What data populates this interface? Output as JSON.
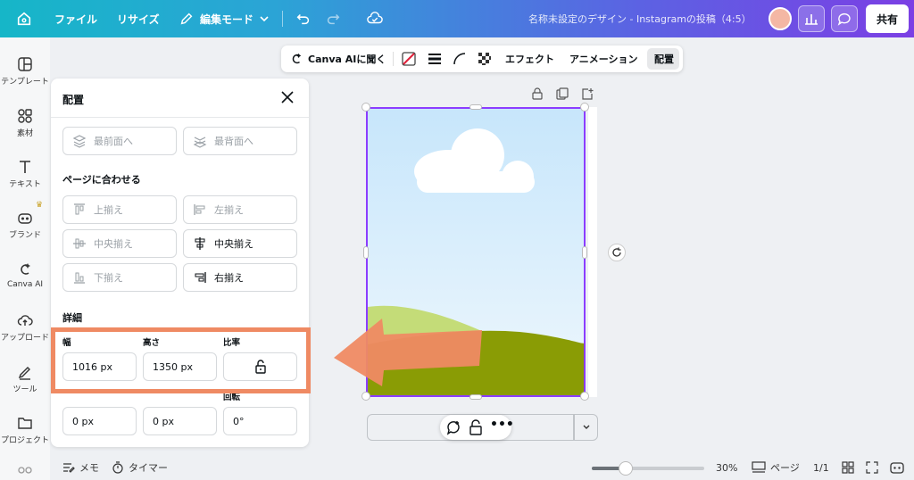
{
  "topbar": {
    "file": "ファイル",
    "resize": "リサイズ",
    "edit_mode": "編集モード",
    "doc_title": "名称未設定のデザイン - Instagramの投稿（4:5）",
    "share": "共有"
  },
  "rail": {
    "templates": "テンプレート",
    "elements": "素材",
    "text": "テキスト",
    "brand": "ブランド",
    "canva_ai": "Canva AI",
    "uploads": "アップロード",
    "tools": "ツール",
    "projects": "プロジェクト"
  },
  "context_toolbar": {
    "ask_ai": "Canva AIに聞く",
    "effects": "エフェクト",
    "animation": "アニメーション",
    "position": "配置"
  },
  "panel": {
    "title": "配置",
    "bring_front": "最前面へ",
    "send_back": "最背面へ",
    "fit_page_heading": "ページに合わせる",
    "align_top": "上揃え",
    "align_left": "左揃え",
    "align_middle": "中央揃え",
    "align_center": "中央揃え",
    "align_bottom": "下揃え",
    "align_right": "右揃え",
    "details_heading": "詳細",
    "width_label": "幅",
    "height_label": "高さ",
    "ratio_label": "比率",
    "width_value": "1016 px",
    "height_value": "1350 px",
    "x_value": "0 px",
    "y_value": "0 px",
    "rotation_label": "回転",
    "rotation_value": "0°"
  },
  "bottom": {
    "notes": "メモ",
    "timer": "タイマー",
    "zoom": "30%",
    "pages": "ページ",
    "page_count": "1/1"
  },
  "colors": {
    "accent": "#8b3dff",
    "highlight": "#ef8a63",
    "sky_top": "#c9e7fb",
    "grass": "#8a9c05",
    "hill": "#c4dc78"
  }
}
